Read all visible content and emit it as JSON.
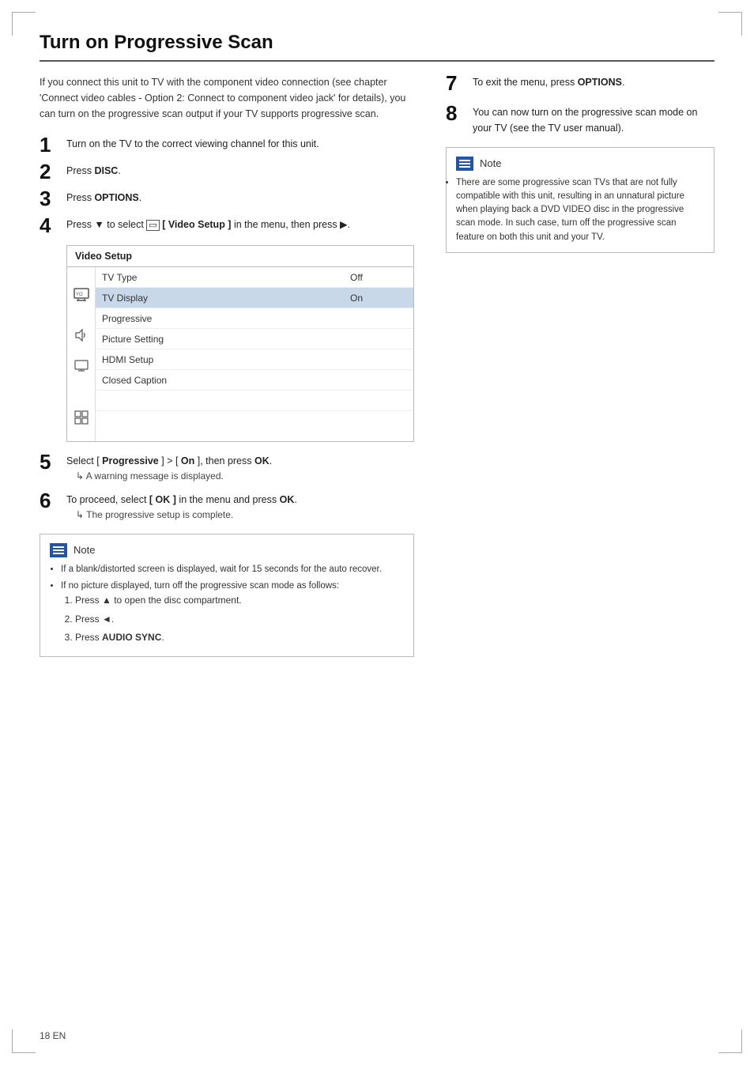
{
  "page": {
    "title": "Turn on Progressive Scan",
    "footer": "18   EN"
  },
  "intro": "If you connect this unit to TV with the component video connection (see chapter 'Connect video cables - Option 2: Connect to component video jack' for details), you can turn on the progressive scan output if your TV supports progressive scan.",
  "steps": [
    {
      "num": "1",
      "text": "Turn on the TV to the correct viewing channel for this unit."
    },
    {
      "num": "2",
      "text_before": "Press ",
      "bold": "DISC",
      "text_after": "."
    },
    {
      "num": "3",
      "text_before": "Press ",
      "bold": "OPTIONS",
      "text_after": "."
    },
    {
      "num": "4",
      "text_before": "Press ▼ to select ",
      "inline_icon": "□",
      "bold": "[ Video Setup ]",
      "text_after": " in the menu, then press ▶."
    }
  ],
  "video_setup": {
    "title": "Video Setup",
    "rows": [
      {
        "label": "TV Type",
        "value": "Off",
        "highlighted": false
      },
      {
        "label": "TV Display",
        "value": "On",
        "highlighted": true
      },
      {
        "label": "Progressive",
        "value": "",
        "highlighted": false
      },
      {
        "label": "Picture Setting",
        "value": "",
        "highlighted": false
      },
      {
        "label": "HDMI Setup",
        "value": "",
        "highlighted": false
      },
      {
        "label": "Closed Caption",
        "value": "",
        "highlighted": false
      },
      {
        "label": "",
        "value": "",
        "highlighted": false
      },
      {
        "label": "",
        "value": "",
        "highlighted": false
      }
    ]
  },
  "steps_continued": [
    {
      "num": "5",
      "text_main": "Select [ Progressive ] > [ On ], then press OK.",
      "sub": "A warning message is displayed."
    },
    {
      "num": "6",
      "text_main": "To proceed, select [ OK ] in the menu and press OK.",
      "sub": "The progressive setup is complete."
    }
  ],
  "note1": {
    "label": "Note",
    "bullets": [
      "If a blank/distorted screen is displayed, wait for 15 seconds for the auto recover.",
      "If no picture displayed, turn off the progressive scan mode as follows:"
    ],
    "numbered": [
      "Press ▲ to open the disc compartment.",
      "Press ◄.",
      "Press AUDIO SYNC."
    ]
  },
  "steps_right": [
    {
      "num": "7",
      "text": "To exit the menu, press OPTIONS."
    },
    {
      "num": "8",
      "text": "You can now turn on the progressive scan mode on your TV (see the TV user manual)."
    }
  ],
  "note2": {
    "label": "Note",
    "bullets": [
      "There are some progressive scan TVs that are not fully compatible with this unit, resulting in an unnatural picture when playing back a DVD VIDEO disc in the progressive scan mode. In such case, turn off the progressive scan feature on both this unit and your TV."
    ]
  },
  "icons": {
    "tv": "📺",
    "speaker": "🔊",
    "monitor": "🖥",
    "grid": "⊞"
  }
}
